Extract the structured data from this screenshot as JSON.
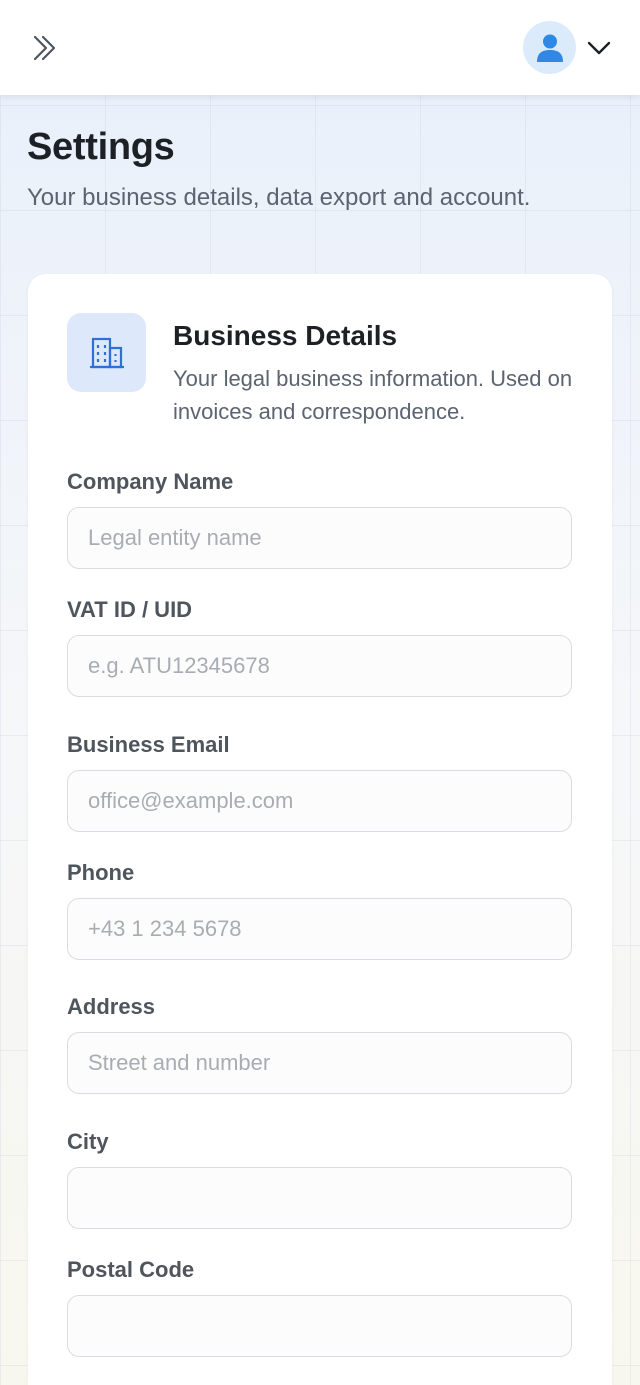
{
  "topbar": {
    "expand_icon": "double-chevron-right-icon",
    "avatar_icon": "user-icon",
    "dropdown_icon": "chevron-down-icon",
    "accent_color": "#2f88e6"
  },
  "page": {
    "title": "Settings",
    "subtitle": "Your business details, data export and account."
  },
  "card": {
    "icon": "building-icon",
    "title": "Business Details",
    "description": "Your legal business information. Used on invoices and correspondence."
  },
  "fields": {
    "company": {
      "label": "Company Name",
      "placeholder": "Legal entity name",
      "value": ""
    },
    "vat": {
      "label": "VAT ID / UID",
      "placeholder": "e.g. ATU12345678",
      "value": ""
    },
    "email": {
      "label": "Business Email",
      "placeholder": "office@example.com",
      "value": ""
    },
    "phone": {
      "label": "Phone",
      "placeholder": "+43 1 234 5678",
      "value": ""
    },
    "address": {
      "label": "Address",
      "placeholder": "Street and number",
      "value": ""
    },
    "city": {
      "label": "City",
      "placeholder": "",
      "value": ""
    },
    "postal": {
      "label": "Postal Code",
      "placeholder": "",
      "value": ""
    }
  }
}
